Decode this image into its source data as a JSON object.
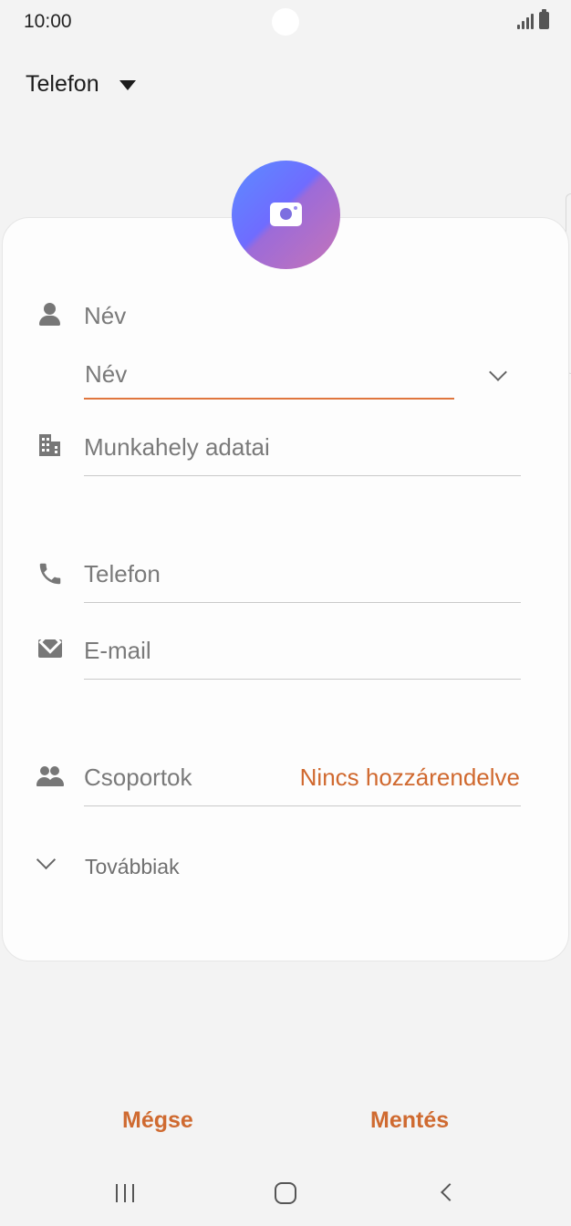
{
  "status_bar": {
    "time": "10:00"
  },
  "header": {
    "account_label": "Telefon"
  },
  "form": {
    "name_section_label": "Név",
    "name_input_placeholder": "Név",
    "workplace_label": "Munkahely adatai",
    "phone_label": "Telefon",
    "email_label": "E-mail",
    "groups_label": "Csoportok",
    "groups_value": "Nincs hozzárendelve",
    "more_label": "Továbbiak"
  },
  "actions": {
    "cancel": "Mégse",
    "save": "Mentés"
  },
  "colors": {
    "accent": "#d0692f",
    "input_underline": "#e0763e"
  }
}
